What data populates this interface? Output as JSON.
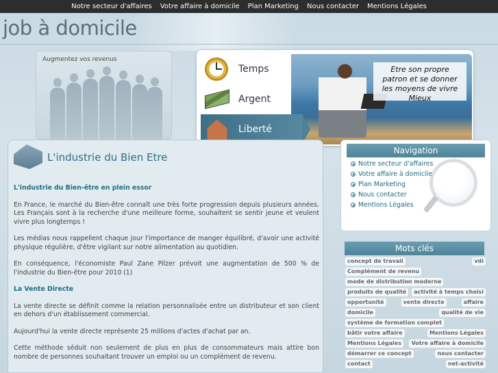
{
  "top_nav": [
    "Notre secteur d'affaires",
    "Votre affaire à domicile",
    "Plan Marketing",
    "Nous contacter",
    "Mentions Légales"
  ],
  "site_title": "job à domicile",
  "people_caption": "Augmentez vos revenus",
  "hero": {
    "items": [
      {
        "label": "Temps",
        "icon": "clock-icon"
      },
      {
        "label": "Argent",
        "icon": "money-icon"
      },
      {
        "label": "Liberté",
        "icon": "house-icon",
        "active": true
      }
    ],
    "quote": "Etre son propre patron et se donner les moyens de vivre Mieux"
  },
  "main": {
    "title": "L'industrie du Bien Etre",
    "section1_title": "L'industrie du Bien-être en plein essor",
    "p1": "En France, le marché du Bien-être connaît une très forte progression depuis plusieurs années. Les Français sont à la recherche d'une meilleure forme, souhaitent se sentir jeune et veulent vivre plus longtemps !",
    "p2": "Les médias nous rappellent chaque jour l'importance de manger équilibré, d'avoir une activité physique régulière, d'être vigilant sur notre alimentation au quotidien.",
    "p3": "En conséquence, l'économiste Paul Zane Pilzer prévoit une augmentation de 500 % de l'industrie du Bien-être pour 2010 (1)",
    "section2_title": "La Vente Directe",
    "p4": "La vente directe se définit comme la relation personnalisée entre un distributeur et son client en dehors d'un établissement commercial.",
    "p5": "Aujourd'hui la vente directe représente 25 millions d'actes d'achat par an.",
    "p6": "Cette méthode séduit non seulement de plus en plus de consommateurs mais attire bon nombre de personnes souhaitant trouver un emploi ou un complément de revenu."
  },
  "navigation": {
    "title": "Navigation",
    "items": [
      "Notre secteur d'affaires",
      "Votre affaire à domicile",
      "Plan Marketing",
      "Nous contacter",
      "Mentions Légales"
    ]
  },
  "keywords": {
    "title": "Mots clés",
    "tags": [
      "concept de travail",
      "vdi",
      "Complément de revenu",
      "mode de distribution moderne",
      "produits de qualité",
      "activité à temps choisi",
      "opportunité",
      "vente directe",
      "affaire",
      "domicile",
      "qualité de vie",
      "système de formation complet",
      "bâtir votre affaire",
      "Mentions Légales",
      "Mentions Légales",
      "Votre affaire à domicile",
      "démarrer ce concept",
      "nous contacter",
      "contact",
      "net-activité"
    ]
  }
}
